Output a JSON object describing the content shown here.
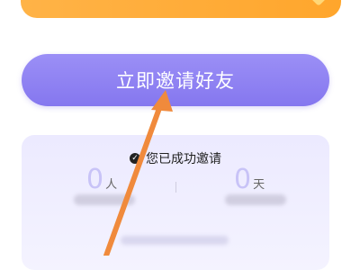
{
  "invite": {
    "button_label": "立即邀请好友"
  },
  "stats": {
    "title": "您已成功邀请",
    "people": {
      "value": "0",
      "unit": "人"
    },
    "days": {
      "value": "0",
      "unit": "天"
    }
  },
  "colors": {
    "banner": "#ffa62c",
    "button": "#8f82f2",
    "card": "#eceaff",
    "arrow": "#f08a3c"
  },
  "icons": {
    "check": "check-circle-icon",
    "arrow": "pointer-arrow-icon"
  }
}
